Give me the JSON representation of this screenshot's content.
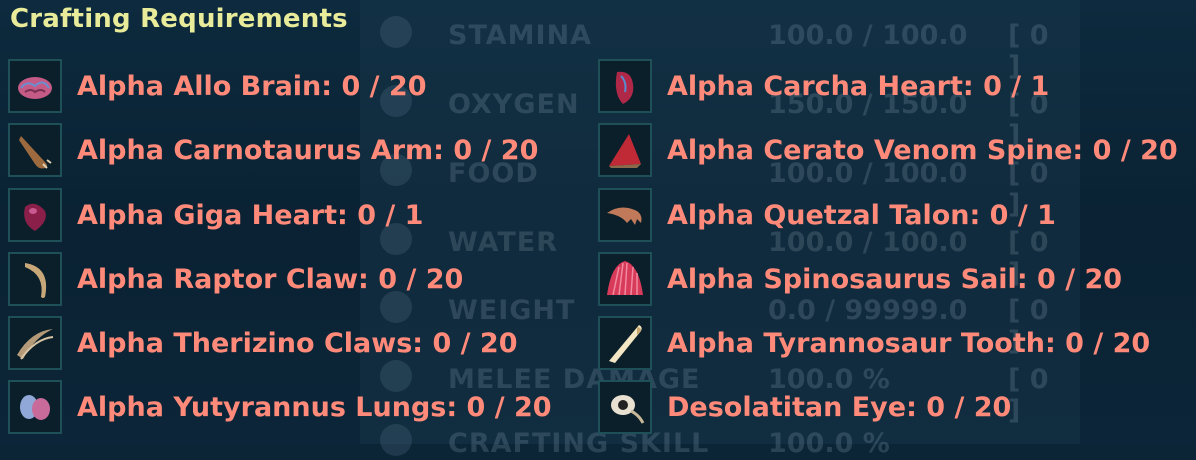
{
  "title": "Crafting Requirements",
  "background_stats": [
    {
      "label": "STAMINA",
      "value": "100.0 / 100.0",
      "level": "[ 0 ]",
      "icon": "lightning-icon"
    },
    {
      "label": "OXYGEN",
      "value": "150.0 / 150.0",
      "level": "[ 0 ]",
      "icon": "oxygen-icon"
    },
    {
      "label": "FOOD",
      "value": "100.0 / 100.0",
      "level": "[ 0 ]",
      "icon": "food-icon"
    },
    {
      "label": "WATER",
      "value": "100.0 / 100.0",
      "level": "[ 0 ]",
      "icon": "water-drop-icon"
    },
    {
      "label": "WEIGHT",
      "value": "0.0 / 99999.0",
      "level": "[ 0 ]",
      "icon": "weight-icon"
    },
    {
      "label": "MELEE DAMAGE",
      "value": "100.0 %",
      "level": "[ 0 ]",
      "icon": "fist-icon"
    },
    {
      "label": "CRAFTING SKILL",
      "value": "100.0 %",
      "level": "",
      "icon": "gear-icon"
    }
  ],
  "requirements_left": [
    {
      "label": "Alpha Allo Brain: 0 / 20",
      "icon": "brain-icon"
    },
    {
      "label": "Alpha Carnotaurus Arm: 0 / 20",
      "icon": "arm-icon"
    },
    {
      "label": "Alpha Giga Heart: 0 / 1",
      "icon": "heart-icon"
    },
    {
      "label": "Alpha Raptor Claw: 0 / 20",
      "icon": "claw-icon"
    },
    {
      "label": "Alpha Therizino Claws: 0 / 20",
      "icon": "claws-icon"
    },
    {
      "label": "Alpha Yutyrannus Lungs: 0 / 20",
      "icon": "lungs-icon"
    }
  ],
  "requirements_right": [
    {
      "label": "Alpha Carcha Heart: 0 / 1",
      "icon": "heart-icon"
    },
    {
      "label": "Alpha Cerato Venom Spine: 0 / 20",
      "icon": "spine-icon"
    },
    {
      "label": "Alpha Quetzal Talon: 0 / 1",
      "icon": "talon-icon"
    },
    {
      "label": "Alpha Spinosaurus Sail: 0 / 20",
      "icon": "sail-icon"
    },
    {
      "label": "Alpha Tyrannosaur Tooth: 0 / 20",
      "icon": "tooth-icon"
    },
    {
      "label": "Desolatitan Eye: 0 / 20",
      "icon": "eye-icon"
    }
  ]
}
